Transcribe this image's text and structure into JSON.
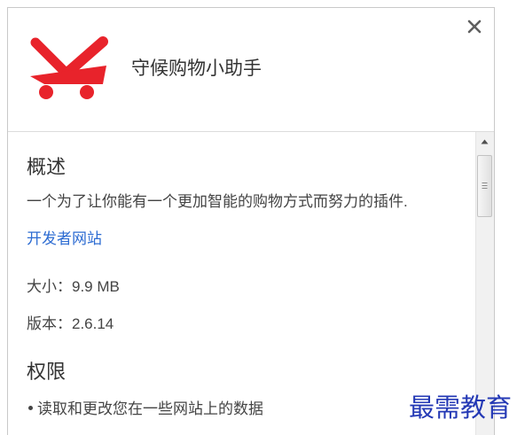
{
  "dialog": {
    "title": "守候购物小助手",
    "logo_icon": "shopping-cart-logo-icon",
    "close_icon": "close-icon"
  },
  "overview": {
    "heading": "概述",
    "description": "一个为了让你能有一个更加智能的购物方式而努力的插件.",
    "developer_link": "开发者网站",
    "size_label": "大小：",
    "size_value": "9.9 MB",
    "version_label": "版本：",
    "version_value": "2.6.14"
  },
  "permissions": {
    "heading": "权限",
    "items": [
      "读取和更改您在一些网站上的数据"
    ]
  },
  "scrollbar": {
    "up_icon": "scroll-up-arrow-icon",
    "scroll_position": 0
  },
  "watermark": "最需教育",
  "colors": {
    "logo_red": "#e8232b",
    "link_blue": "#2d6cd2",
    "watermark_blue": "#2439b5",
    "text": "#333333"
  }
}
